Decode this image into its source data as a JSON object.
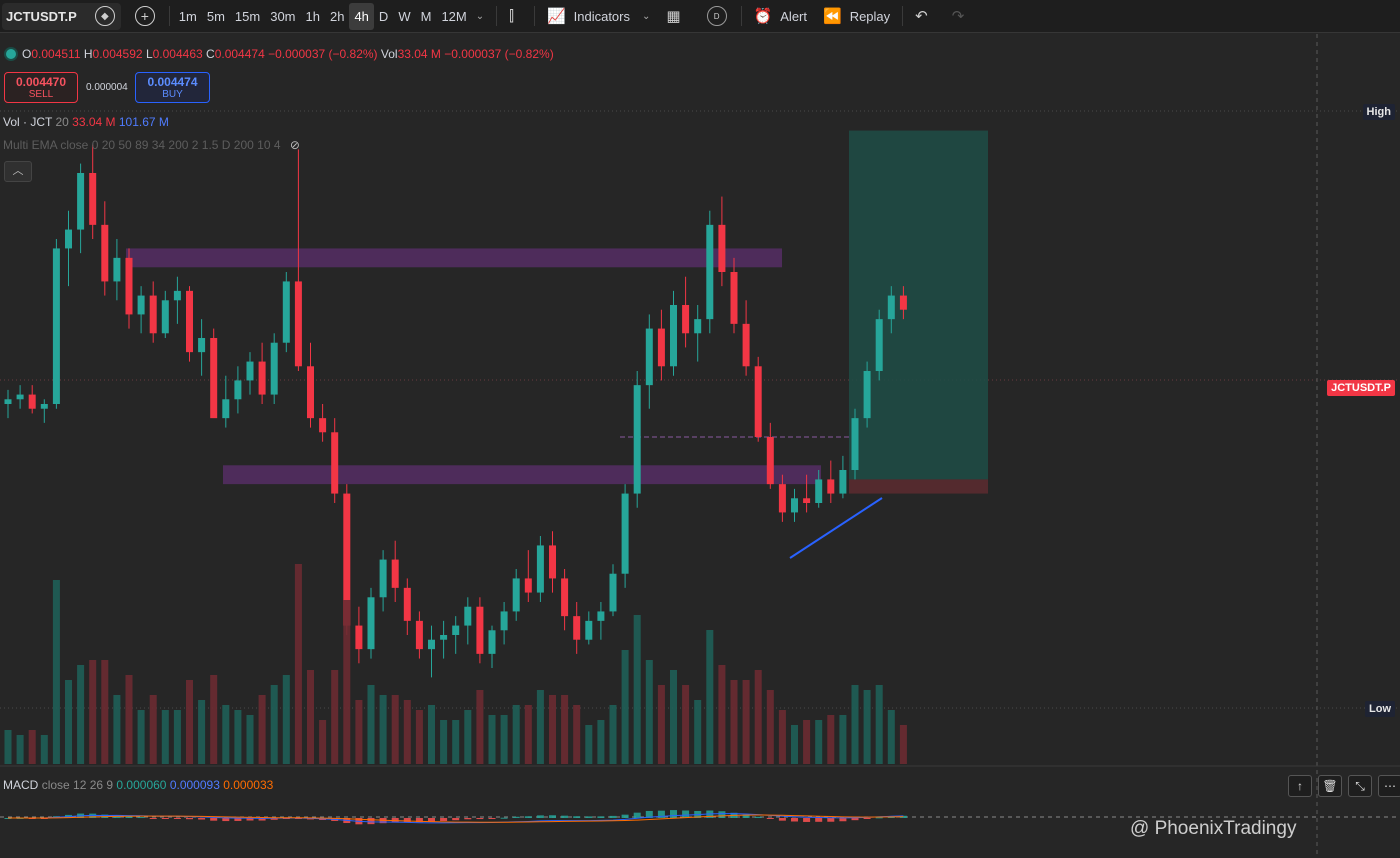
{
  "toolbar": {
    "symbol": "JCTUSDT.P",
    "intervals": [
      "1m",
      "5m",
      "15m",
      "30m",
      "1h",
      "2h",
      "4h",
      "D",
      "W",
      "M",
      "12M"
    ],
    "active_interval": "4h",
    "indicators_label": "Indicators",
    "layout_badge": "D",
    "alert_label": "Alert",
    "replay_label": "Replay"
  },
  "ohlc": {
    "o_label": "O",
    "o": "0.004511",
    "h_label": "H",
    "h": "0.004592",
    "l_label": "L",
    "l": "0.004463",
    "c_label": "C",
    "c": "0.004474",
    "change": "−0.000037 (−0.82%)",
    "vol_label": "Vol",
    "vol": "33.04 M",
    "vol_change": "−0.000037 (−0.82%)"
  },
  "trade": {
    "sell_price": "0.004470",
    "sell_label": "SELL",
    "spread": "0.000004",
    "buy_price": "0.004474",
    "buy_label": "BUY"
  },
  "volume_legend": {
    "name": "Vol · JCT",
    "length": "20",
    "v1": "33.04 M",
    "v2": "101.67 M"
  },
  "ema_legend": "Multi EMA close 0 20 50 89 34 200 2 1.5 D 200 10 4",
  "price_labels": {
    "high": "High",
    "low": "Low",
    "symbol_tag": "JCTUSDT.P"
  },
  "macd_legend": {
    "name": "MACD",
    "params": "close 12 26 9",
    "hist": "0.000060",
    "macd": "0.000093",
    "signal": "0.000033"
  },
  "watermark": "@ PhoenixTradingy",
  "colors": {
    "up": "#26a69a",
    "down": "#f23645",
    "zone": "#5c2f6e",
    "long_profit": "#1f4d46",
    "long_stop": "#5a2b30",
    "trendline": "#2962ff",
    "macd_line": "#2962ff",
    "signal_line": "#ff6d00"
  },
  "chart_data": {
    "type": "candlestick",
    "title": "JCTUSDT.P 4h",
    "y_scale": "price",
    "candles": [
      [
        0.00405,
        0.00408,
        0.00402,
        0.00406
      ],
      [
        0.00406,
        0.00409,
        0.00404,
        0.00407
      ],
      [
        0.00407,
        0.00409,
        0.00403,
        0.00404
      ],
      [
        0.00404,
        0.00406,
        0.00401,
        0.00405
      ],
      [
        0.00405,
        0.0044,
        0.00404,
        0.00438
      ],
      [
        0.00438,
        0.00446,
        0.0043,
        0.00442
      ],
      [
        0.00442,
        0.00456,
        0.00437,
        0.00454
      ],
      [
        0.00454,
        0.0046,
        0.0044,
        0.00443
      ],
      [
        0.00443,
        0.00448,
        0.00428,
        0.00431
      ],
      [
        0.00431,
        0.0044,
        0.00427,
        0.00436
      ],
      [
        0.00436,
        0.00438,
        0.00421,
        0.00424
      ],
      [
        0.00424,
        0.0043,
        0.0042,
        0.00428
      ],
      [
        0.00428,
        0.00431,
        0.00418,
        0.0042
      ],
      [
        0.0042,
        0.00429,
        0.00419,
        0.00427
      ],
      [
        0.00427,
        0.00432,
        0.00422,
        0.00429
      ],
      [
        0.00429,
        0.0043,
        0.00414,
        0.00416
      ],
      [
        0.00416,
        0.00423,
        0.00411,
        0.00419
      ],
      [
        0.00419,
        0.00421,
        0.00404,
        0.00402
      ],
      [
        0.00402,
        0.00411,
        0.004,
        0.00406
      ],
      [
        0.00406,
        0.00413,
        0.00403,
        0.0041
      ],
      [
        0.0041,
        0.00416,
        0.00407,
        0.00414
      ],
      [
        0.00414,
        0.00418,
        0.00405,
        0.00407
      ],
      [
        0.00407,
        0.0042,
        0.00405,
        0.00418
      ],
      [
        0.00418,
        0.00433,
        0.00416,
        0.00431
      ],
      [
        0.00431,
        0.00459,
        0.00412,
        0.00413
      ],
      [
        0.00413,
        0.00418,
        0.004,
        0.00402
      ],
      [
        0.00402,
        0.00405,
        0.00397,
        0.00399
      ],
      [
        0.00399,
        0.00402,
        0.00384,
        0.00386
      ],
      [
        0.00386,
        0.00388,
        0.00356,
        0.00358
      ],
      [
        0.00358,
        0.00362,
        0.0035,
        0.00353
      ],
      [
        0.00353,
        0.00366,
        0.00351,
        0.00364
      ],
      [
        0.00364,
        0.00374,
        0.00361,
        0.00372
      ],
      [
        0.00372,
        0.00376,
        0.00363,
        0.00366
      ],
      [
        0.00366,
        0.00368,
        0.00356,
        0.00359
      ],
      [
        0.00359,
        0.00361,
        0.00351,
        0.00353
      ],
      [
        0.00353,
        0.00358,
        0.00347,
        0.00355
      ],
      [
        0.00355,
        0.00359,
        0.00351,
        0.00356
      ],
      [
        0.00356,
        0.0036,
        0.00352,
        0.00358
      ],
      [
        0.00358,
        0.00364,
        0.00354,
        0.00362
      ],
      [
        0.00362,
        0.00364,
        0.0035,
        0.00352
      ],
      [
        0.00352,
        0.00358,
        0.00349,
        0.00357
      ],
      [
        0.00357,
        0.00363,
        0.00354,
        0.00361
      ],
      [
        0.00361,
        0.0037,
        0.00359,
        0.00368
      ],
      [
        0.00368,
        0.00374,
        0.00363,
        0.00365
      ],
      [
        0.00365,
        0.00377,
        0.00363,
        0.00375
      ],
      [
        0.00375,
        0.00378,
        0.00365,
        0.00368
      ],
      [
        0.00368,
        0.0037,
        0.00357,
        0.0036
      ],
      [
        0.0036,
        0.00363,
        0.00352,
        0.00355
      ],
      [
        0.00355,
        0.00361,
        0.00354,
        0.00359
      ],
      [
        0.00359,
        0.00363,
        0.00355,
        0.00361
      ],
      [
        0.00361,
        0.00371,
        0.0036,
        0.00369
      ],
      [
        0.00369,
        0.00388,
        0.00366,
        0.00386
      ],
      [
        0.00386,
        0.00412,
        0.00383,
        0.00409
      ],
      [
        0.00409,
        0.00424,
        0.00404,
        0.00421
      ],
      [
        0.00421,
        0.00425,
        0.0041,
        0.00413
      ],
      [
        0.00413,
        0.00429,
        0.00411,
        0.00426
      ],
      [
        0.00426,
        0.00432,
        0.00417,
        0.0042
      ],
      [
        0.0042,
        0.00426,
        0.00414,
        0.00423
      ],
      [
        0.00423,
        0.00446,
        0.0042,
        0.00443
      ],
      [
        0.00443,
        0.00449,
        0.0043,
        0.00433
      ],
      [
        0.00433,
        0.00436,
        0.0042,
        0.00422
      ],
      [
        0.00422,
        0.00427,
        0.00411,
        0.00413
      ],
      [
        0.00413,
        0.00415,
        0.00397,
        0.00398
      ],
      [
        0.00398,
        0.00401,
        0.00387,
        0.00388
      ],
      [
        0.00388,
        0.0039,
        0.0038,
        0.00382
      ],
      [
        0.00382,
        0.00387,
        0.0038,
        0.00385
      ],
      [
        0.00385,
        0.0039,
        0.00382,
        0.00384
      ],
      [
        0.00384,
        0.00391,
        0.00383,
        0.00389
      ],
      [
        0.00389,
        0.00393,
        0.00384,
        0.00386
      ],
      [
        0.00386,
        0.00394,
        0.00385,
        0.00391
      ],
      [
        0.00391,
        0.00404,
        0.00389,
        0.00402
      ],
      [
        0.00402,
        0.00414,
        0.004,
        0.00412
      ],
      [
        0.00412,
        0.00425,
        0.0041,
        0.00423
      ],
      [
        0.00423,
        0.0043,
        0.0042,
        0.00428
      ],
      [
        0.00428,
        0.0043,
        0.00423,
        0.00425
      ]
    ],
    "annotations": {
      "resistance_zone_top": [
        0.00438,
        0.00434
      ],
      "support_zone_mid": [
        0.00392,
        0.00388
      ],
      "mid_level": 0.00398,
      "long_position": {
        "target": 0.00463,
        "entry": 0.00389,
        "stop": 0.00386
      }
    }
  }
}
